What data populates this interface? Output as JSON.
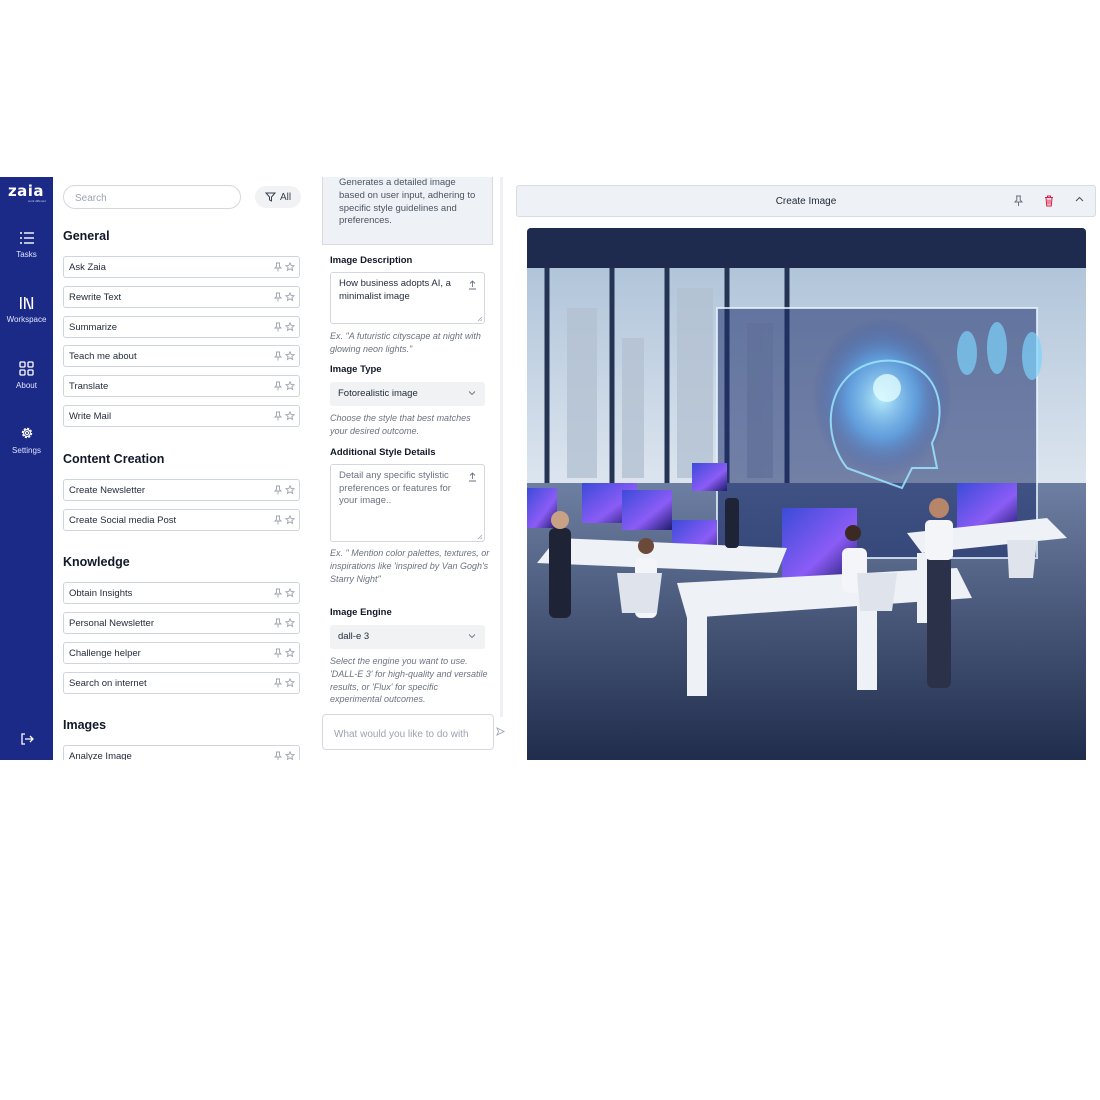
{
  "app": {
    "logo_text": "zaia",
    "logo_tagline": "work different",
    "brand_color": "#1b2a86"
  },
  "nav": {
    "items": [
      {
        "label": "Tasks",
        "icon": "list-icon"
      },
      {
        "label": "Workspace",
        "icon": "library-icon"
      },
      {
        "label": "About",
        "icon": "grid-icon"
      },
      {
        "label": "Settings",
        "icon": "gear-icon"
      }
    ],
    "logout_icon": "logout-icon"
  },
  "tasks_panel": {
    "search_placeholder": "Search",
    "filter_label": "All",
    "sections": [
      {
        "title": "General",
        "items": [
          "Ask Zaia",
          "Rewrite Text",
          "Summarize",
          "Teach me about",
          "Translate",
          "Write Mail"
        ]
      },
      {
        "title": "Content Creation",
        "items": [
          "Create Newsletter",
          "Create Social media Post"
        ]
      },
      {
        "title": "Knowledge",
        "items": [
          "Obtain Insights",
          "Personal Newsletter",
          "Challenge helper",
          "Search on internet"
        ]
      },
      {
        "title": "Images",
        "items": [
          "Analyze Image"
        ]
      }
    ]
  },
  "task_form": {
    "description": "Generates a detailed image based on user input, adhering to specific style guidelines and preferences.",
    "fields": {
      "image_description": {
        "label": "Image Description",
        "value": "How business adopts AI, a minimalist image",
        "hint": "Ex. \"A futuristic cityscape at night with glowing neon lights.\""
      },
      "image_type": {
        "label": "Image Type",
        "value": "Fotorealistic image",
        "hint": "Choose the style that best matches your desired outcome."
      },
      "additional_style": {
        "label": "Additional Style Details",
        "placeholder": "Detail any specific stylistic preferences or features for your image..",
        "hint": "Ex. \" Mention color palettes, textures, or inspirations like 'inspired by Van Gogh's Starry Night\""
      },
      "image_engine": {
        "label": "Image Engine",
        "value": "dall-e 3",
        "hint": "Select the engine you want to use. 'DALL-E 3' for high-quality and versatile results, or 'Flux' for specific experimental outcomes."
      }
    },
    "chat_placeholder": "What would you like to do with"
  },
  "result_panel": {
    "title": "Create Image",
    "actions": [
      "pin-icon",
      "trash-icon",
      "chevron-up-icon"
    ],
    "danger_color": "#e11d48"
  }
}
